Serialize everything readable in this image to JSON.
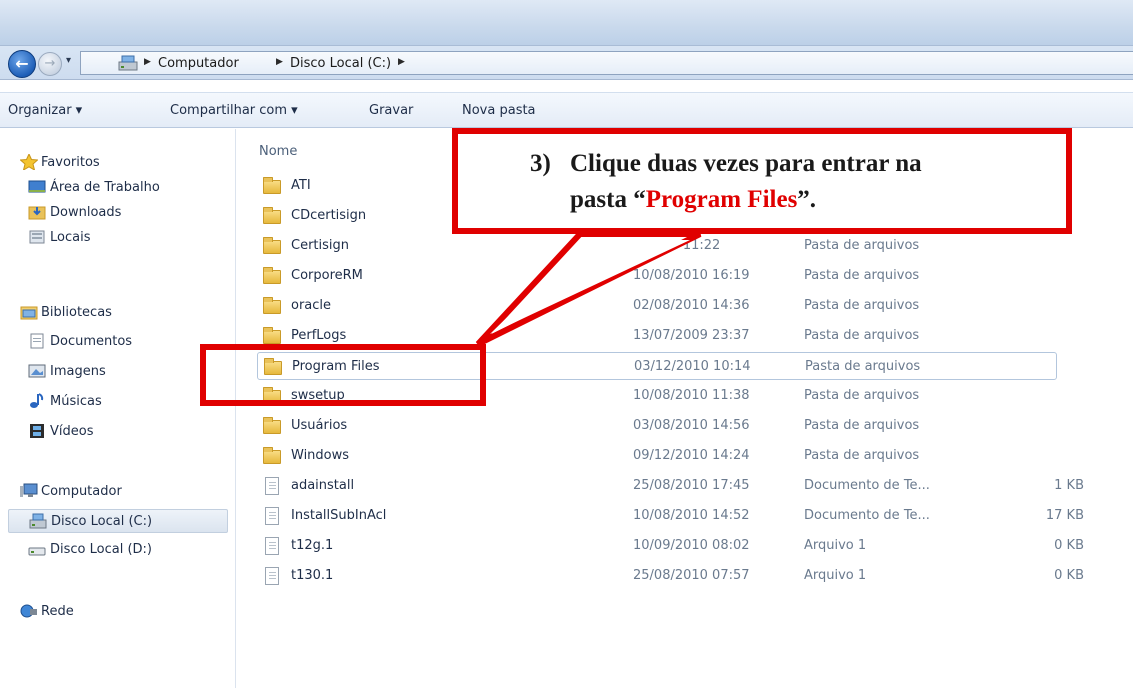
{
  "breadcrumb": {
    "items": [
      "Computador",
      "Disco Local (C:)"
    ]
  },
  "toolbar": {
    "organize": "Organizar ▾",
    "share": "Compartilhar com ▾",
    "burn": "Gravar",
    "new_folder": "Nova pasta"
  },
  "sidebar": {
    "favorites": "Favoritos",
    "desktop": "Área de Trabalho",
    "downloads": "Downloads",
    "places": "Locais",
    "libraries": "Bibliotecas",
    "documents": "Documentos",
    "images": "Imagens",
    "music": "Músicas",
    "videos": "Vídeos",
    "computer": "Computador",
    "drive_c": "Disco Local (C:)",
    "drive_d": "Disco Local (D:)",
    "network": "Rede"
  },
  "list": {
    "col_name": "Nome",
    "rows": [
      {
        "name": "ATI",
        "date": "",
        "type": "",
        "size": "",
        "icon": "folder"
      },
      {
        "name": "CDcertisign",
        "date": "",
        "type": "",
        "size": "",
        "icon": "folder"
      },
      {
        "name": "Certisign",
        "date": "2/2010 11:22",
        "type": "Pasta de arquivos",
        "size": "",
        "icon": "folder"
      },
      {
        "name": "CorporeRM",
        "date": "10/08/2010 16:19",
        "type": "Pasta de arquivos",
        "size": "",
        "icon": "folder"
      },
      {
        "name": "oracle",
        "date": "02/08/2010 14:36",
        "type": "Pasta de arquivos",
        "size": "",
        "icon": "folder"
      },
      {
        "name": "PerfLogs",
        "date": "13/07/2009 23:37",
        "type": "Pasta de arquivos",
        "size": "",
        "icon": "folder"
      },
      {
        "name": "Program Files",
        "date": "03/12/2010 10:14",
        "type": "Pasta de arquivos",
        "size": "",
        "icon": "folder"
      },
      {
        "name": "swsetup",
        "date": "10/08/2010 11:38",
        "type": "Pasta de arquivos",
        "size": "",
        "icon": "folder"
      },
      {
        "name": "Usuários",
        "date": "03/08/2010 14:56",
        "type": "Pasta de arquivos",
        "size": "",
        "icon": "folder"
      },
      {
        "name": "Windows",
        "date": "09/12/2010 14:24",
        "type": "Pasta de arquivos",
        "size": "",
        "icon": "folder"
      },
      {
        "name": "adainstall",
        "date": "25/08/2010 17:45",
        "type": "Documento de Te...",
        "size": "1 KB",
        "icon": "document"
      },
      {
        "name": "InstallSubInAcl",
        "date": "10/08/2010 14:52",
        "type": "Documento de Te...",
        "size": "17 KB",
        "icon": "document"
      },
      {
        "name": "t12g.1",
        "date": "10/09/2010 08:02",
        "type": "Arquivo 1",
        "size": "0 KB",
        "icon": "document"
      },
      {
        "name": "t130.1",
        "date": "25/08/2010 07:57",
        "type": "Arquivo 1",
        "size": "0 KB",
        "icon": "document"
      }
    ]
  },
  "callout": {
    "number": "3)",
    "line1": "Clique duas vezes para entrar na",
    "line2_prefix": "pasta “",
    "line2_highlight": "Program Files",
    "line2_suffix": "”.",
    "color": "#e00000"
  }
}
